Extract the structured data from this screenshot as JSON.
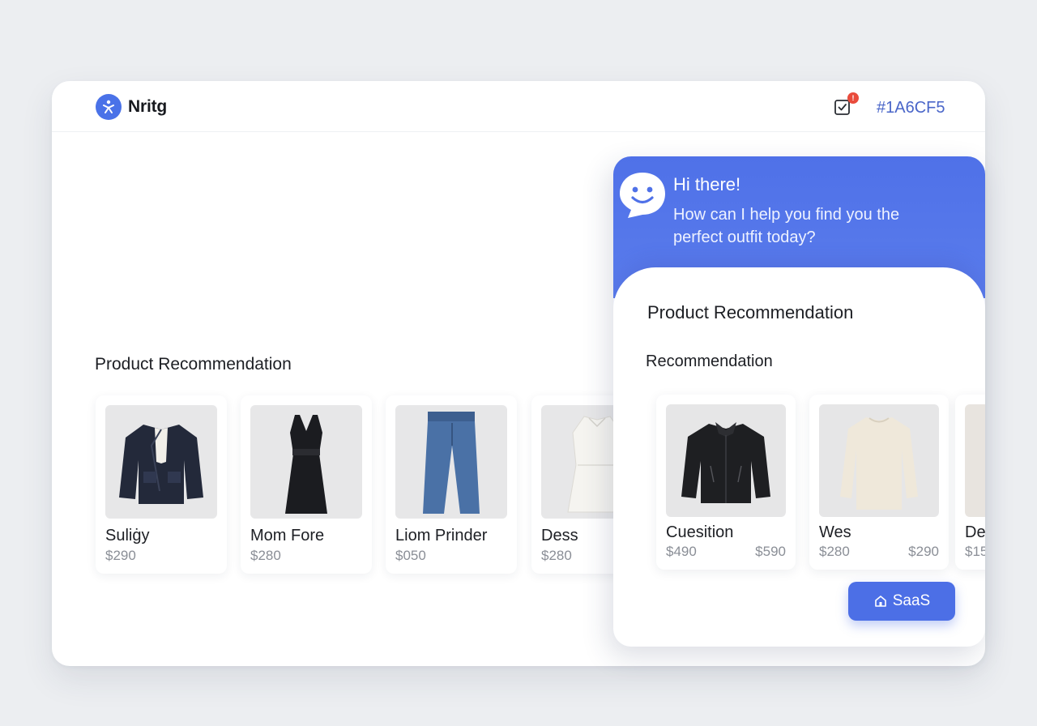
{
  "header": {
    "brand_name": "Nritg",
    "brand_icon": "figure-logo-icon",
    "task_icon": "checkbox-task-icon",
    "notification_count": "!",
    "color_code": "#1A6CF5"
  },
  "main": {
    "section_title": "Product Recommendation",
    "products": [
      {
        "name": "Suliġy",
        "price": "$290",
        "image": "navy-wool-coat"
      },
      {
        "name": "Mom Fore",
        "price": "$280",
        "image": "black-sleeveless-dress"
      },
      {
        "name": "Liom Prinder",
        "price": "$050",
        "image": "blue-jeans"
      },
      {
        "name": "Dess",
        "price": "$280",
        "image": "white-dress"
      }
    ]
  },
  "chat": {
    "greeting": "Hi there!",
    "message": "How can I help you find you the perfect outfit today?",
    "title": "Product Recommendation",
    "subtitle": "Recommendation",
    "products": [
      {
        "name": "Cuesition",
        "price": "$490",
        "price2": "$590",
        "image": "black-jacket"
      },
      {
        "name": "Wes",
        "price": "$280",
        "price2": "$290",
        "image": "cream-sweater"
      },
      {
        "name": "De",
        "price": "$15",
        "price2": "",
        "image": "tan-item"
      }
    ],
    "button_label": "SaaS",
    "button_icon": "home-icon"
  },
  "colors": {
    "accent": "#4c6fe6",
    "background": "#eceef1",
    "notification": "#e94b3c"
  }
}
